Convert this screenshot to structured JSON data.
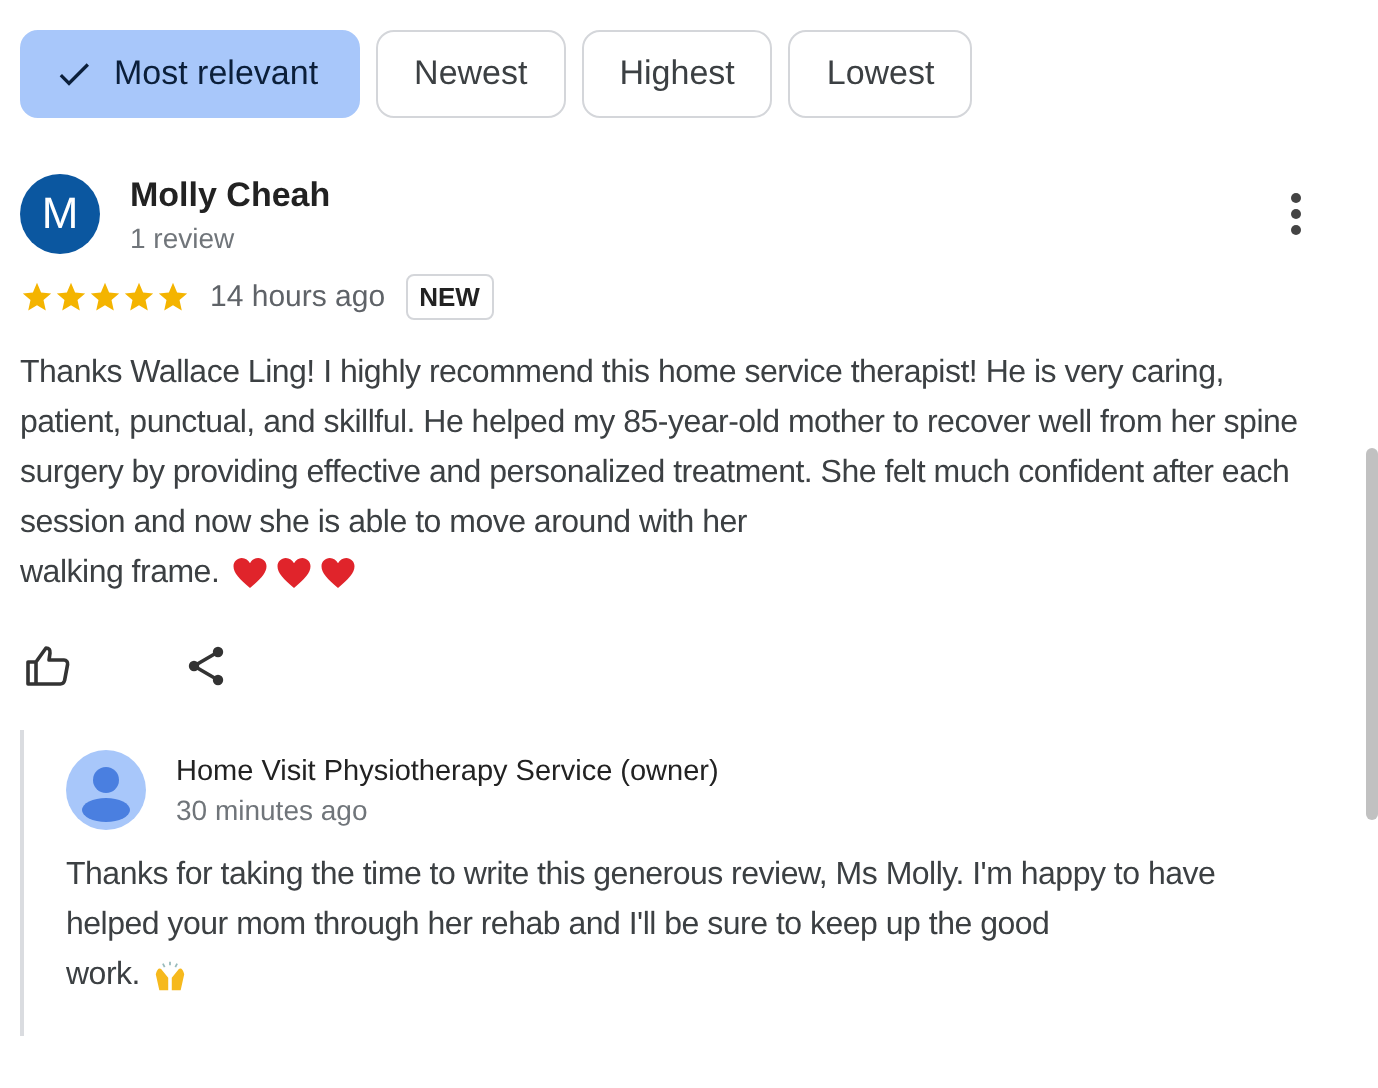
{
  "filters": [
    {
      "label": "Most relevant",
      "selected": true
    },
    {
      "label": "Newest",
      "selected": false
    },
    {
      "label": "Highest",
      "selected": false
    },
    {
      "label": "Lowest",
      "selected": false
    }
  ],
  "review": {
    "avatar_letter": "M",
    "author": "Molly Cheah",
    "meta": "1 review",
    "stars": 5,
    "time": "14 hours ago",
    "badge": "NEW",
    "text": "Thanks Wallace Ling! I highly recommend this home service therapist! He is very caring, patient, punctual, and skillful. He helped my 85-year-old mother to recover well from her spine surgery by providing effective and personalized treatment. She felt much confident after each session and now she is able to move around with her",
    "text_end": "walking frame."
  },
  "owner_reply": {
    "author": "Home Visit Physiotherapy Service (owner)",
    "time": "30 minutes ago",
    "text": "Thanks for taking the time to write this generous review, Ms Molly. I'm happy to have helped your mom through her rehab and I'll be sure to keep up the good",
    "text_end": "work."
  }
}
